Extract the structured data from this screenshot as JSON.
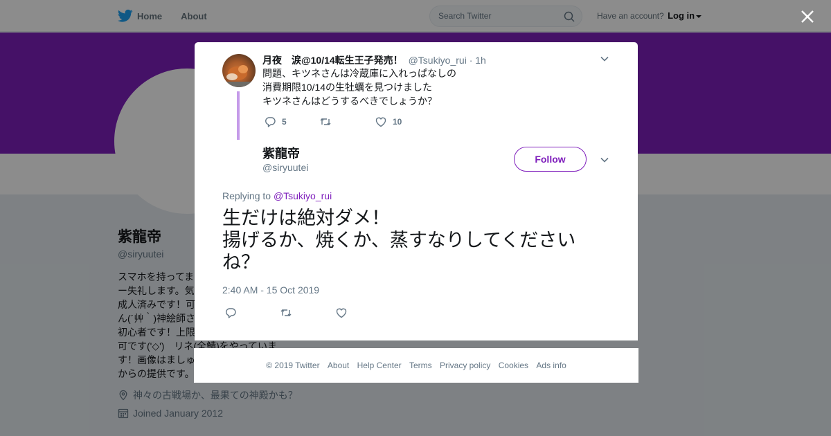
{
  "nav": {
    "home": "Home",
    "about": "About",
    "search_placeholder": "Search Twitter",
    "have_account": "Have an account?",
    "login": "Log in"
  },
  "profile": {
    "name": "紫龍帝",
    "handle": "@siryuutei",
    "bio": "スマホを持ってま\nー失礼します。気\n成人済みです！可\nん(´艸｀)神絵師さ\n初心者です！上限\n可です('◇')　リネ(全鯖)をやっていま\nす！画像はましゅ\nからの提供です。",
    "location": "神々の古戦場か、最果ての神殿かも？",
    "joined": "Joined January 2012"
  },
  "parent_tweet": {
    "name": "月夜　涙@10/14転生王子発売！",
    "handle": "@Tsukiyo_rui",
    "time": "· 1h",
    "text": "問題、キツネさんは冷蔵庫に入れっぱなしの\n消費期限10/14の生牡蠣を見つけました\nキツネさんはどうするべきでしょうか？",
    "replies": "5",
    "retweets": "",
    "likes": "10"
  },
  "main_tweet": {
    "name": "紫龍帝",
    "handle": "@siryuutei",
    "follow": "Follow",
    "replying_prefix": "Replying to",
    "replying_to": "@Tsukiyo_rui",
    "text": "生だけは絶対ダメ！\n揚げるか、焼くか、蒸すなりしてください\nね？",
    "timestamp": "2:40 AM - 15 Oct 2019"
  },
  "footer": {
    "copyright": "© 2019 Twitter",
    "about": "About",
    "help": "Help Center",
    "terms": "Terms",
    "privacy": "Privacy policy",
    "cookies": "Cookies",
    "ads": "Ads info"
  },
  "colors": {
    "brand": "#7f1fbc",
    "twitter_blue": "#1da1f2",
    "muted": "#657786"
  },
  "icons": {
    "logo": "twitter-bird-icon",
    "search": "search-icon",
    "close": "close-icon",
    "reply": "reply-icon",
    "retweet": "retweet-icon",
    "like": "heart-icon",
    "more": "chevron-down-icon",
    "location": "location-pin-icon",
    "calendar": "calendar-icon"
  }
}
